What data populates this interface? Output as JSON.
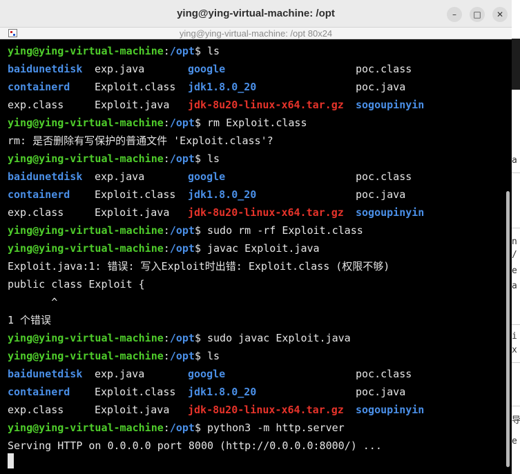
{
  "window": {
    "title": "ying@ying-virtual-machine: /opt",
    "tab_title": "ying@ying-virtual-machine: /opt 80x24",
    "minimize_glyph": "–",
    "maximize_glyph": "□",
    "close_glyph": "✕"
  },
  "prompt": {
    "user_host": "ying@ying-virtual-machine",
    "colon": ":",
    "path": "/opt",
    "symbol": "$ "
  },
  "commands": {
    "ls": "ls",
    "rm": "rm Exploit.class",
    "sudo_rm": "sudo rm -rf Exploit.class",
    "javac": "javac Exploit.java",
    "sudo_javac": "sudo javac Exploit.java",
    "http": "python3 -m http.server"
  },
  "listing": {
    "r1": [
      "baidunetdisk",
      "exp.java",
      "google",
      "poc.class"
    ],
    "r2": [
      "containerd",
      "Exploit.class",
      "jdk1.8.0_20",
      "poc.java"
    ],
    "r3": [
      "exp.class",
      "Exploit.java",
      "jdk-8u20-linux-x64.tar.gz",
      "sogoupinyin"
    ]
  },
  "output": {
    "rm_confirm": "rm: 是否删除有写保护的普通文件 'Exploit.class'?",
    "javac_error": "Exploit.java:1: 错误: 写入Exploit时出错: Exploit.class (权限不够)",
    "javac_code": "public class Exploit {",
    "javac_caret": "       ^",
    "javac_count": "1 个错误",
    "http_serving": "Serving HTTP on 0.0.0.0 port 8000 (http://0.0.0.0:8000/) ..."
  },
  "colors": {
    "prompt_user": "#4fce2b",
    "directory": "#4a8fe7",
    "archive": "#e6332a",
    "text": "#e6e6e6",
    "background": "#000000"
  },
  "icons": [
    "minimize-icon",
    "maximize-icon",
    "close-icon",
    "terminal-tab-icon"
  ]
}
